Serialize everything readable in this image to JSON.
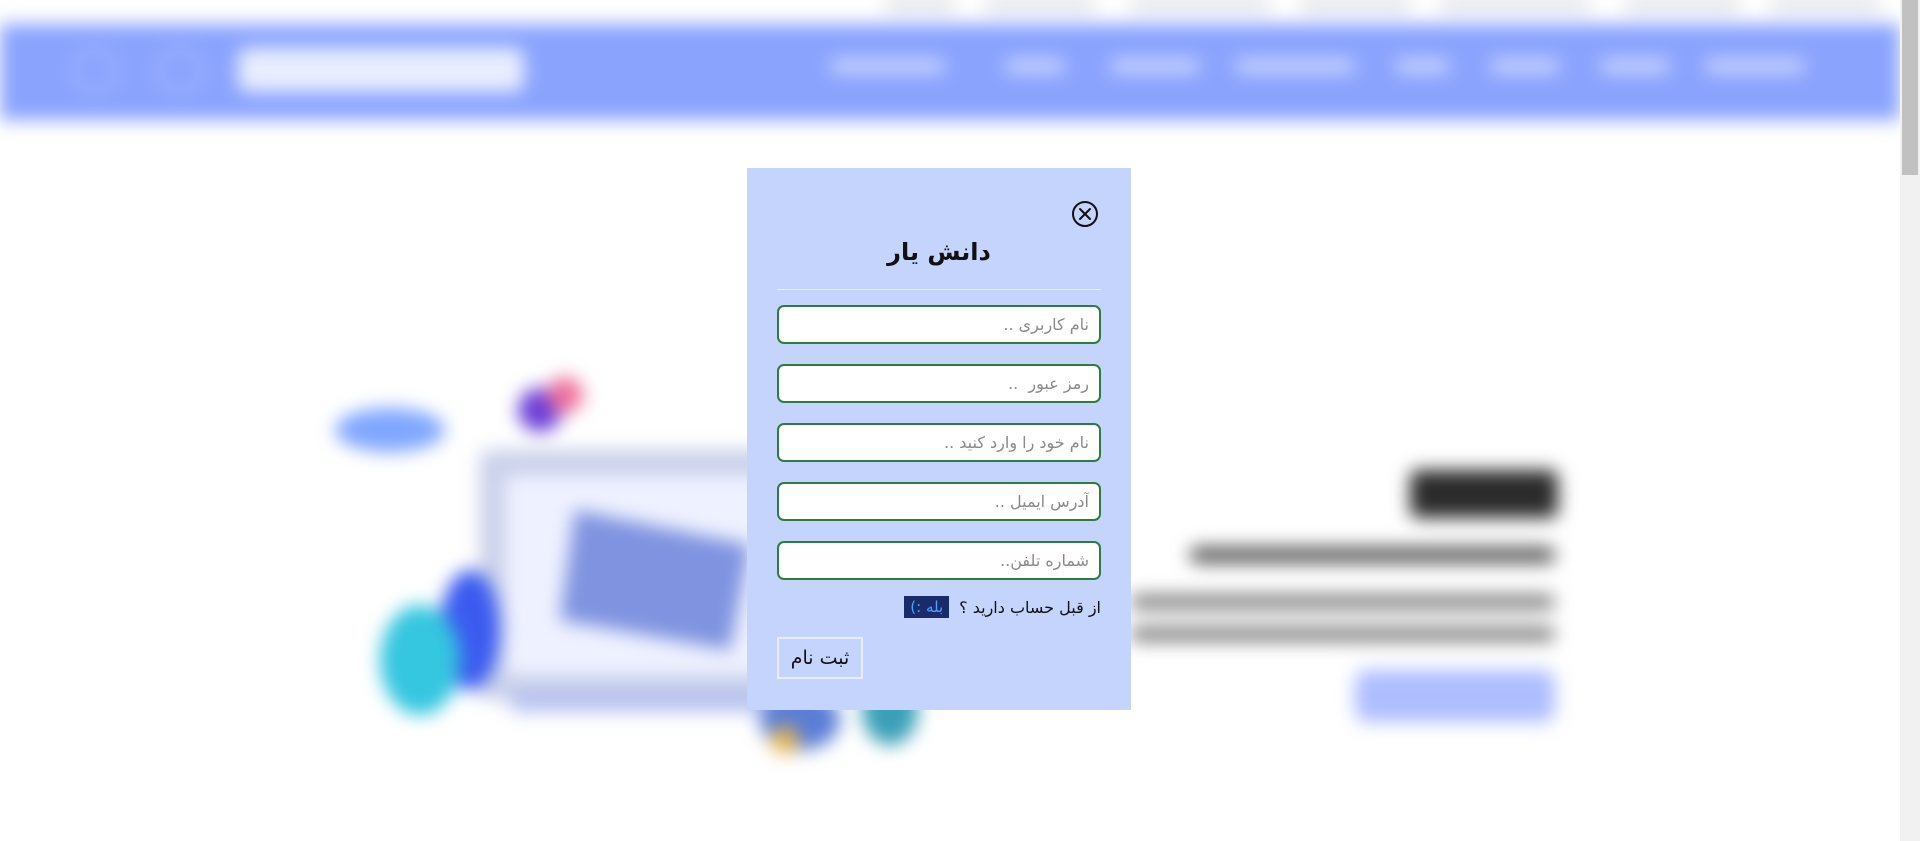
{
  "modal": {
    "title": "دانش یار",
    "close_icon": "close-circle-icon",
    "fields": {
      "username_placeholder": "نام کاربری ..",
      "password_placeholder": "رمز عبور  ..",
      "fullname_placeholder": "نام خود را وارد کنید ..",
      "email_placeholder": "آدرس ایمیل ..",
      "phone_placeholder": "شماره تلفن.."
    },
    "login_prompt": "از قبل حساب دارید ؟",
    "login_link": "بله :)",
    "submit_label": "ثبت نام"
  },
  "colors": {
    "modal_bg": "#c4d4fd",
    "navbar_bg": "#8aa3fd",
    "field_border": "#2e7d3e",
    "link_bg": "#1a2b6b",
    "link_text": "#4da3ff"
  }
}
